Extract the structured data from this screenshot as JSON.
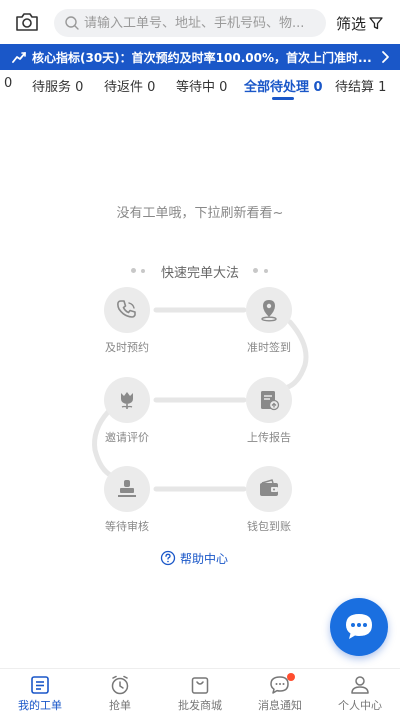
{
  "search": {
    "placeholder": "请输入工单号、地址、手机号码、物..."
  },
  "filter": {
    "label": "筛选"
  },
  "banner": {
    "text": "核心指标(30天)：首次预约及时率100.00%，首次上门准时..."
  },
  "tabs": [
    {
      "label": "0"
    },
    {
      "label": "待服务 0"
    },
    {
      "label": "待返件 0"
    },
    {
      "label": "等待中 0"
    },
    {
      "label": "全部待处理 0",
      "active": true
    },
    {
      "label": "待结算 1"
    }
  ],
  "empty": {
    "message": "没有工单哦，下拉刷新看看~"
  },
  "guide": {
    "title": "快速完单大法",
    "steps": [
      {
        "label": "及时预约",
        "icon": "phone-icon"
      },
      {
        "label": "准时签到",
        "icon": "location-pin-icon"
      },
      {
        "label": "上传报告",
        "icon": "upload-report-icon"
      },
      {
        "label": "邀请评价",
        "icon": "flower-icon"
      },
      {
        "label": "等待审核",
        "icon": "stamp-icon"
      },
      {
        "label": "钱包到账",
        "icon": "wallet-icon"
      }
    ]
  },
  "help": {
    "label": "帮助中心"
  },
  "bottom_nav": [
    {
      "label": "我的工单",
      "icon": "work-order-icon",
      "active": true
    },
    {
      "label": "抢单",
      "icon": "alarm-clock-icon"
    },
    {
      "label": "批发商城",
      "icon": "shopping-bag-icon"
    },
    {
      "label": "消息通知",
      "icon": "message-icon",
      "badge": true
    },
    {
      "label": "个人中心",
      "icon": "user-icon"
    }
  ],
  "colors": {
    "accent": "#1a57c8",
    "badge": "#ff4d2e",
    "fab": "#1a6fe0"
  }
}
